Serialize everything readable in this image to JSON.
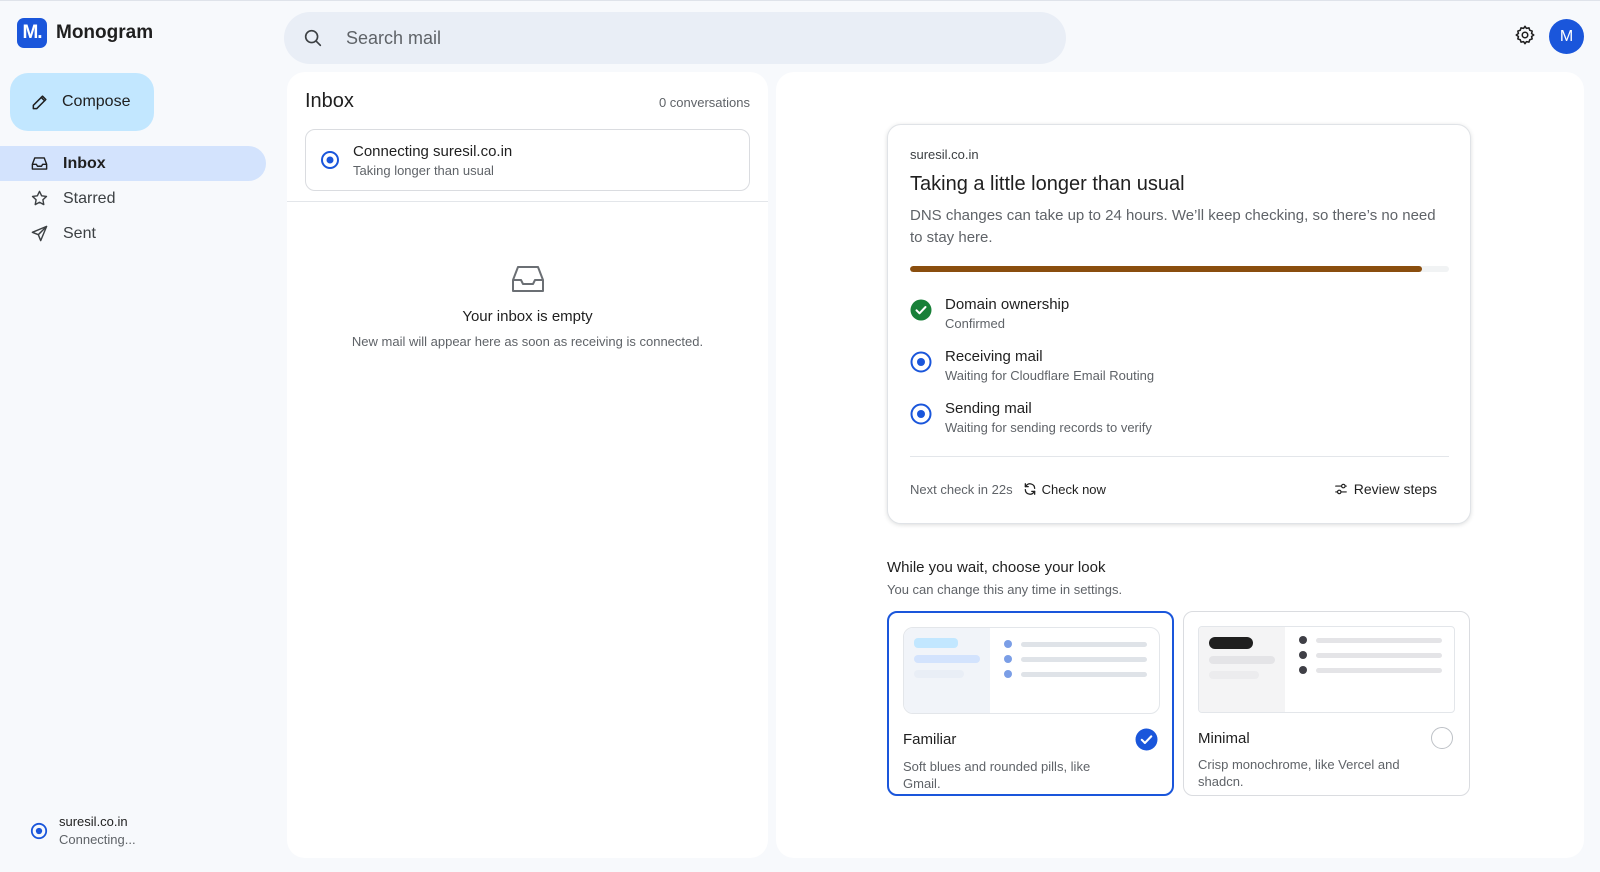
{
  "app": {
    "logo_letter": "M.",
    "name": "Monogram"
  },
  "sidebar": {
    "compose_label": "Compose",
    "items": [
      {
        "label": "Inbox",
        "icon": "inbox-icon",
        "active": true
      },
      {
        "label": "Starred",
        "icon": "star-icon",
        "active": false
      },
      {
        "label": "Sent",
        "icon": "send-icon",
        "active": false
      }
    ],
    "domain_status": {
      "domain": "suresil.co.in",
      "state": "Connecting..."
    }
  },
  "header": {
    "search_placeholder": "Search mail",
    "avatar_letter": "M"
  },
  "inbox": {
    "title": "Inbox",
    "count": "0 conversations",
    "connecting_card": {
      "title": "Connecting suresil.co.in",
      "subtitle": "Taking longer than usual"
    },
    "empty_title": "Your inbox is empty",
    "empty_subtitle": "New mail will appear here as soon as receiving is connected."
  },
  "status_card": {
    "domain": "suresil.co.in",
    "title": "Taking a little longer than usual",
    "description": "DNS changes can take up to 24 hours. We’ll keep checking, so there’s no need to stay here.",
    "progress_fraction": 0.95,
    "steps": [
      {
        "title": "Domain ownership",
        "subtitle": "Confirmed",
        "status": "done"
      },
      {
        "title": "Receiving mail",
        "subtitle": "Waiting for Cloudflare Email Routing",
        "status": "pending"
      },
      {
        "title": "Sending mail",
        "subtitle": "Waiting for sending records to verify",
        "status": "pending"
      }
    ],
    "next_check": "Next check in 22s",
    "check_now_label": "Check now",
    "review_steps_label": "Review steps"
  },
  "look": {
    "title": "While you wait, choose your look",
    "subtitle": "You can change this any time in settings.",
    "themes": [
      {
        "name": "Familiar",
        "description": "Soft blues and rounded pills, like Gmail.",
        "selected": true
      },
      {
        "name": "Minimal",
        "description": "Crisp monochrome, like Vercel and shadcn.",
        "selected": false
      }
    ]
  },
  "colors": {
    "brand": "#1a56db",
    "compose_bg": "#c2e7ff",
    "nav_active_bg": "#d3e3fd",
    "progress": "#8a4e0e",
    "success": "#188038"
  }
}
